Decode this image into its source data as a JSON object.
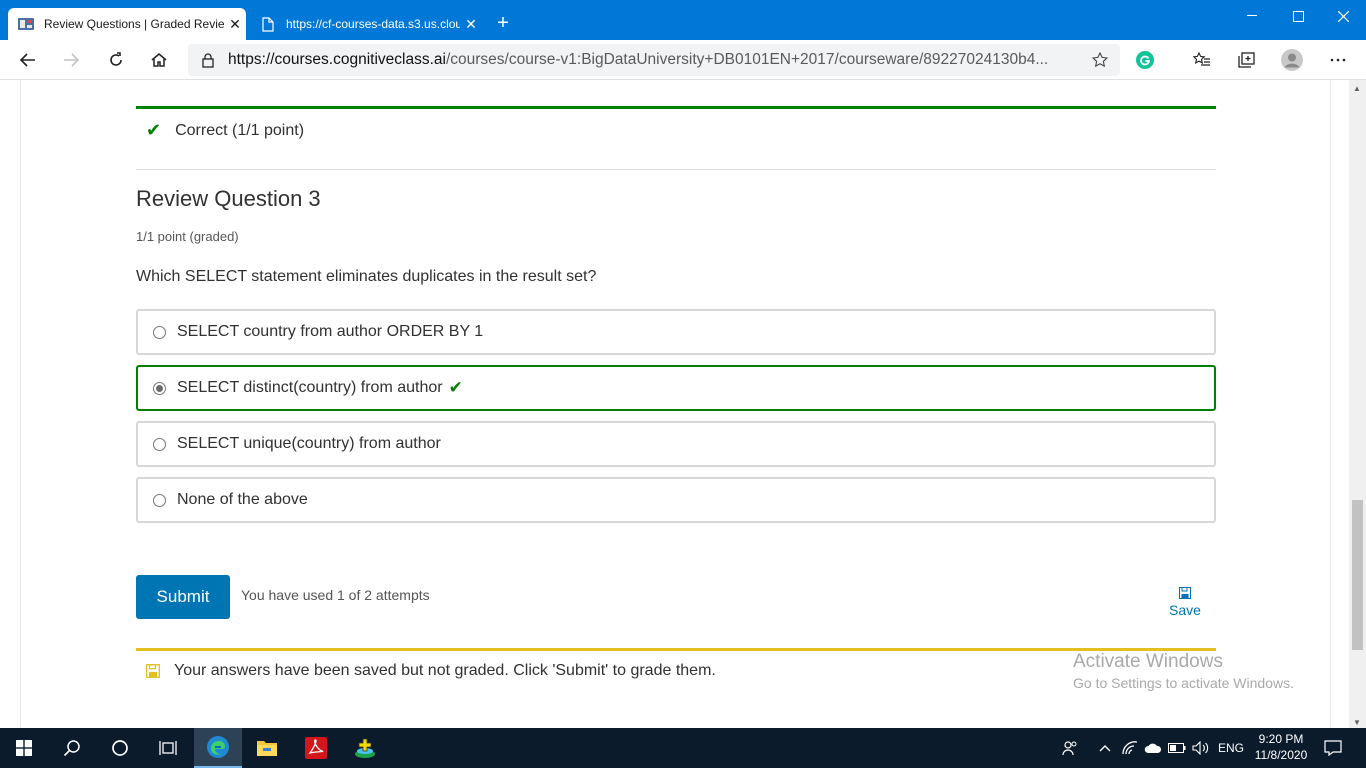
{
  "browser": {
    "tabs": [
      {
        "title": "Review Questions | Graded Revie",
        "active": true
      },
      {
        "title": "https://cf-courses-data.s3.us.clou",
        "active": false
      }
    ],
    "close_glyph": "✕",
    "new_tab_glyph": "+",
    "url_host": "https://courses.cognitiveclass.ai",
    "url_path": "/courses/course-v1:BigDataUniversity+DB0101EN+2017/courseware/89227024130b4..."
  },
  "page": {
    "prev_result": "Correct (1/1 point)",
    "question": {
      "title": "Review Question 3",
      "points": "1/1 point (graded)",
      "text": "Which SELECT statement eliminates duplicates in the result set?"
    },
    "options": [
      {
        "label": "SELECT country from author ORDER BY 1",
        "selected": false
      },
      {
        "label": "SELECT distinct(country) from author",
        "selected": true
      },
      {
        "label": "SELECT unique(country) from author",
        "selected": false
      },
      {
        "label": "None of the above",
        "selected": false
      }
    ],
    "submit_label": "Submit",
    "attempts_text": "You have used 1 of 2 attempts",
    "save_label": "Save",
    "notice_text": "Your answers have been saved but not graded. Click 'Submit' to grade them."
  },
  "watermark": {
    "line1": "Activate Windows",
    "line2": "Go to Settings to activate Windows."
  },
  "taskbar": {
    "lang": "ENG",
    "time": "9:20 PM",
    "date": "11/8/2020"
  },
  "colors": {
    "accent_blue": "#0078d7",
    "correct_green": "#008100",
    "submit_blue": "#0075b4",
    "notice_yellow": "#e2c01f"
  }
}
